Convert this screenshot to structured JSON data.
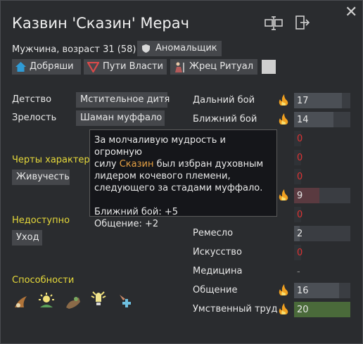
{
  "header": {
    "name": "Казвин 'Сказин' Мерач",
    "info": "Мужчина, возраст 31 (58)",
    "ideology_badge": "Аномальщик",
    "close_glyph": "✕"
  },
  "factions": [
    {
      "label": "Добряши",
      "icon": "house-icon",
      "color": "#2f9bd6"
    },
    {
      "label": "Пути Власти",
      "icon": "triangle-icon",
      "color": "#d84a4a"
    },
    {
      "label": "Жрец Ритуал",
      "icon": "priest-icon",
      "color": "#c98a6a"
    }
  ],
  "backstory": {
    "childhood_label": "Детство",
    "childhood_value": "Мстительное дитя",
    "adulthood_label": "Зрелость",
    "adulthood_value": "Шаман муффало"
  },
  "traits": {
    "header": "Черты характера",
    "items": [
      "Живучесть"
    ]
  },
  "incapable": {
    "header": "Недоступно",
    "items": [
      "Уход"
    ]
  },
  "abilities": {
    "header": "Способности",
    "icons": [
      "shockwave-icon",
      "sun-burst-icon",
      "animal-hand-icon",
      "radiance-icon",
      "heal-arrow-icon"
    ]
  },
  "skills": [
    {
      "name": "Дальний бой",
      "value": "17",
      "level": 17,
      "passion": "major",
      "color": "#e8e8e8"
    },
    {
      "name": "Ближний бой",
      "value": "14",
      "level": 14,
      "passion": "major",
      "color": "#e8e8e8"
    },
    {
      "name": "",
      "value": "0",
      "level": 0,
      "passion": "none",
      "color": "#d33"
    },
    {
      "name": "",
      "value": "0",
      "level": 0,
      "passion": "none",
      "color": "#d33"
    },
    {
      "name": "",
      "value": "0",
      "level": 0,
      "passion": "none",
      "color": "#d33"
    },
    {
      "name": "",
      "value": "9",
      "level": 9,
      "passion": "major",
      "color": "#e8e8e8",
      "highlight": "#5a3a40"
    },
    {
      "name": "",
      "value": "0",
      "level": 0,
      "passion": "none",
      "color": "#d33"
    },
    {
      "name": "Ремесло",
      "value": "2",
      "level": 2,
      "passion": "none",
      "color": "#e8e8e8"
    },
    {
      "name": "Искусство",
      "value": "0",
      "level": 0,
      "passion": "none",
      "color": "#d33"
    },
    {
      "name": "Медицина",
      "value": "-",
      "level": 0,
      "passion": "none",
      "color": "#8a8a8a"
    },
    {
      "name": "Общение",
      "value": "16",
      "level": 16,
      "passion": "major",
      "color": "#e8e8e8"
    },
    {
      "name": "Умственный труд",
      "value": "20",
      "level": 20,
      "passion": "major",
      "color": "#e8e8e8",
      "highlight": "#4a6a3a"
    }
  ],
  "tooltip": {
    "line1": "За молчаливую мудрость и огромную",
    "line2_pre": "силу ",
    "line2_name": "Сказин",
    "line2_post": " был избран духовным",
    "line3": "лидером кочевого племени,",
    "line4": "следующего за стадами муффало.",
    "stat1": "Ближний бой: +5",
    "stat2": "Общение: +2"
  }
}
